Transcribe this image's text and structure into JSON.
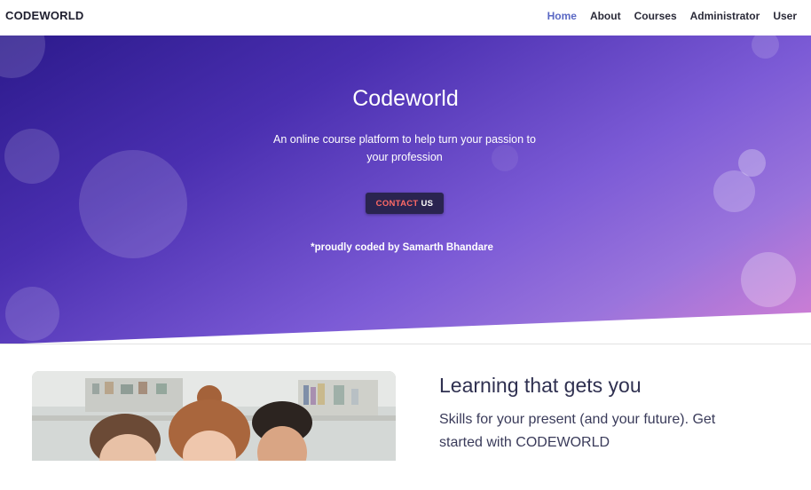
{
  "navbar": {
    "brand": "CODEWORLD",
    "links": [
      {
        "label": "Home",
        "active": true
      },
      {
        "label": "About",
        "active": false
      },
      {
        "label": "Courses",
        "active": false
      },
      {
        "label": "Administrator",
        "active": false
      },
      {
        "label": "User",
        "active": false
      }
    ]
  },
  "hero": {
    "title": "Codeworld",
    "subtitle": "An online course platform to help turn your passion to your profession",
    "contact_button": {
      "part1": "CONTACT",
      "part2": "US"
    },
    "credit": "*proudly coded by Samarth Bhandare"
  },
  "feature": {
    "title": "Learning that gets you",
    "text": "Skills for your present (and your future). Get started with CODEWORLD"
  },
  "colors": {
    "nav_active": "#5a68c4",
    "hero_start": "#2c1a8c",
    "hero_end": "#d67fd3",
    "button_bg": "#2a2450",
    "button_accent": "#ff6a66"
  }
}
